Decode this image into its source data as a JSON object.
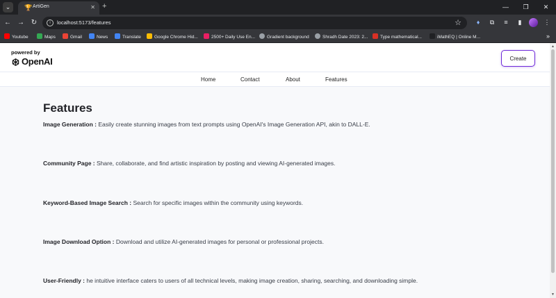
{
  "browser": {
    "tab_title": "ArtiGen",
    "url": "localhost:5173/features",
    "bookmarks": [
      {
        "label": "Youtube",
        "color": "#ff0000"
      },
      {
        "label": "Maps",
        "color": "#34a853"
      },
      {
        "label": "Gmail",
        "color": "#ea4335"
      },
      {
        "label": "News",
        "color": "#4285f4"
      },
      {
        "label": "Translate",
        "color": "#4285f4"
      },
      {
        "label": "Google Chrome Hid...",
        "color": "#fbbc04"
      },
      {
        "label": "2500+ Daily Use En...",
        "color": "#e91e63"
      },
      {
        "label": "Gradient background",
        "color": "#9aa0a6"
      },
      {
        "label": "Shradh Date 2023: 2...",
        "color": "#9aa0a6"
      },
      {
        "label": "Type mathematical...",
        "color": "#d93025"
      },
      {
        "label": "iMathEQ | Online M...",
        "color": "#202124"
      }
    ]
  },
  "header": {
    "powered_by": "powered by",
    "brand": "OpenAI",
    "create_label": "Create"
  },
  "nav": {
    "home": "Home",
    "contact": "Contact",
    "about": "About",
    "features": "Features"
  },
  "main": {
    "title": "Features",
    "features": [
      {
        "name": "Image Generation :",
        "desc": " Easily create stunning images from text prompts using OpenAI's Image Generation API, akin to DALL-E."
      },
      {
        "name": "Community Page :",
        "desc": " Share, collaborate, and find artistic inspiration by posting and viewing AI-generated images."
      },
      {
        "name": "Keyword-Based Image Search :",
        "desc": " Search for specific images within the community using keywords."
      },
      {
        "name": "Image Download Option :",
        "desc": " Download and utilize AI-generated images for personal or professional projects."
      },
      {
        "name": "User-Friendly :",
        "desc": " he intuitive interface caters to users of all technical levels, making image creation, sharing, searching, and downloading simple."
      }
    ]
  }
}
